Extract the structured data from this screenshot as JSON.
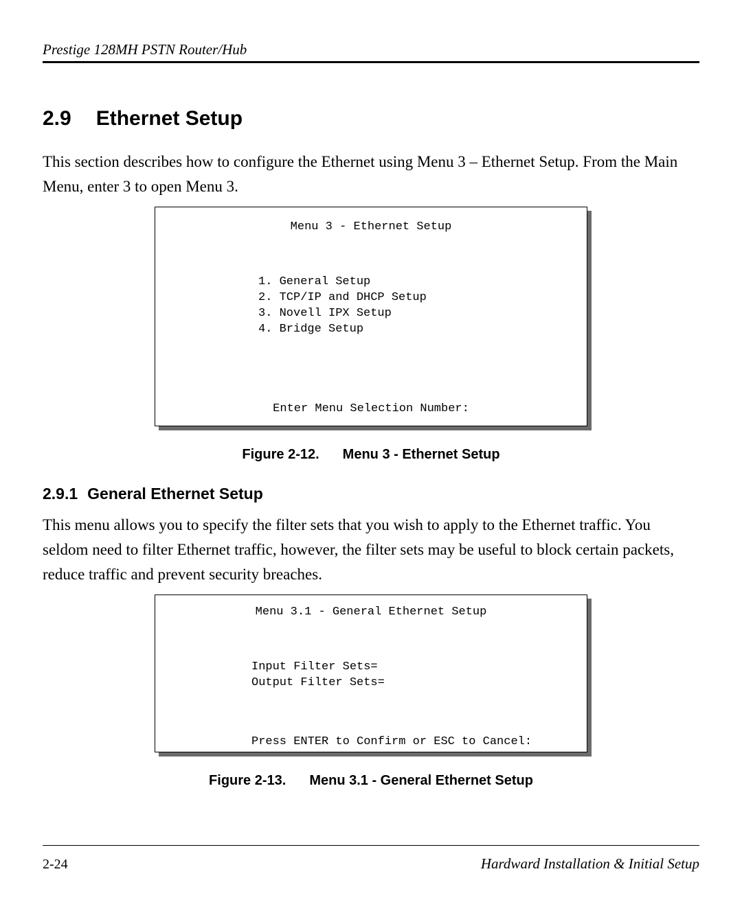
{
  "header": {
    "running_head": "Prestige 128MH  PSTN Router/Hub"
  },
  "section": {
    "number": "2.9",
    "title": "Ethernet Setup",
    "intro": "This section describes how to configure the Ethernet using Menu 3 – Ethernet Setup.  From the Main Menu, enter 3 to open Menu 3."
  },
  "menu3": {
    "title": "Menu 3 - Ethernet Setup",
    "items": [
      "1. General Setup",
      "2. TCP/IP and DHCP Setup",
      "3. Novell IPX Setup",
      "4. Bridge Setup"
    ],
    "prompt": "Enter Menu Selection Number:"
  },
  "fig12": {
    "label": "Figure 2-12.",
    "caption": "Menu 3 - Ethernet Setup"
  },
  "subsection": {
    "number": "2.9.1",
    "title": "General Ethernet Setup",
    "body": "This menu allows you to specify the filter sets that you wish to apply to the Ethernet traffic.  You seldom need to filter Ethernet traffic, however, the filter sets may be useful to block certain packets, reduce traffic and prevent security breaches."
  },
  "menu31": {
    "title": "Menu 3.1 - General Ethernet Setup",
    "field1": "Input Filter Sets=",
    "field2": "Output Filter Sets=",
    "prompt": "Press ENTER to Confirm or ESC to Cancel:"
  },
  "fig13": {
    "label": "Figure 2-13.",
    "caption": "Menu 3.1 - General Ethernet Setup"
  },
  "footer": {
    "page": "2-24",
    "title": "Hardward Installation & Initial Setup"
  }
}
